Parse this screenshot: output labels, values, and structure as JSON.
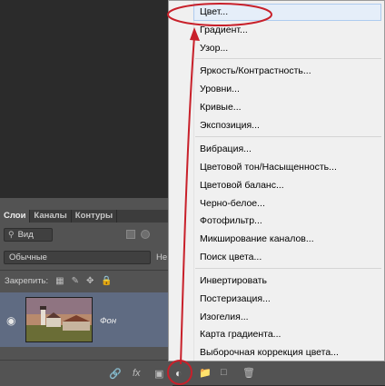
{
  "layers_panel": {
    "tabs": [
      "Слои",
      "Каналы",
      "Контуры"
    ],
    "filter_label": "Вид",
    "blend_mode": "Обычные",
    "opacity_label": "Не",
    "lock_label": "Закрепить:",
    "layer_name": "Фон"
  },
  "menu": {
    "items": [
      "Цвет...",
      "Градиент...",
      "Узор...",
      "Яркость/Контрастность...",
      "Уровни...",
      "Кривые...",
      "Экспозиция...",
      "Вибрация...",
      "Цветовой тон/Насыщенность...",
      "Цветовой баланс...",
      "Черно-белое...",
      "Фотофильтр...",
      "Микширование каналов...",
      "Поиск цвета...",
      "Инвертировать",
      "Постеризация...",
      "Изогелия...",
      "Карта градиента...",
      "Выборочная коррекция цвета..."
    ]
  },
  "colors": {
    "annotation": "#c8202a",
    "highlight": "#e5eef9",
    "selected_layer": "#5f6b82"
  },
  "icons": [
    "search-icon",
    "eye-icon",
    "link-icon",
    "fx-icon",
    "mask-icon",
    "adjustment-layer-icon",
    "folder-icon",
    "new-layer-icon",
    "trash-icon"
  ]
}
